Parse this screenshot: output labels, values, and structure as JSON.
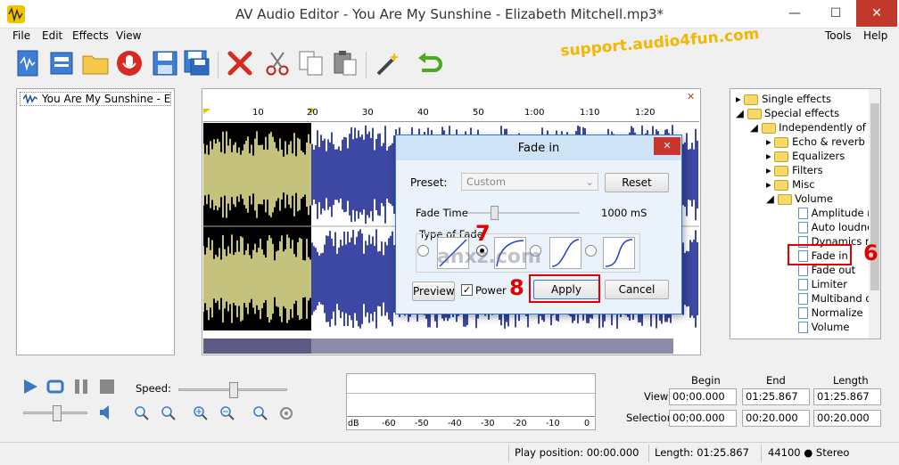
{
  "window": {
    "title": "AV Audio Editor - You Are My Sunshine - Elizabeth Mitchell.mp3*",
    "min": "—",
    "max": "☐",
    "close": "✕"
  },
  "menu": {
    "file": "File",
    "edit": "Edit",
    "effects": "Effects",
    "view": "View",
    "tools": "Tools",
    "help": "Help"
  },
  "brand": "support.audio4fun.com",
  "file_item": "You Are My Sunshine - Elizabe",
  "timeline": {
    "ticks": [
      "10",
      "20",
      "30",
      "40",
      "50",
      "1:00",
      "1:10",
      "1:20"
    ]
  },
  "close_wave": "✕",
  "tree": {
    "single_effects": "Single effects",
    "special_effects": "Special effects",
    "independently": "Independently of cha",
    "echo": "Echo & reverb",
    "equalizers": "Equalizers",
    "filters": "Filters",
    "misc": "Misc",
    "volume": "Volume",
    "items": [
      "Amplitude mo",
      "Auto loudnes",
      "Dynamics mo",
      "Fade in",
      "Fade out",
      "Limiter",
      "Multiband dy",
      "Normalize",
      "Volume"
    ]
  },
  "dialog": {
    "title": "Fade in",
    "preset_label": "Preset:",
    "preset_value": "Custom",
    "reset": "Reset",
    "fade_time_label": "Fade Time",
    "fade_time_value": "1000 mS",
    "type_label": "Type of Fade",
    "preview": "Preview",
    "power": "Power",
    "apply": "Apply",
    "cancel": "Cancel"
  },
  "markers": {
    "six": "6",
    "seven": "7",
    "eight": "8"
  },
  "watermark": "anxz.com",
  "transport": {
    "speed_label": "Speed:"
  },
  "meter": {
    "ticks": [
      "dB",
      "-60",
      "-50",
      "-40",
      "-30",
      "-20",
      "-10",
      "0"
    ]
  },
  "positions": {
    "begin_label": "Begin",
    "end_label": "End",
    "length_label": "Length",
    "view_label": "View",
    "selection_label": "Selection",
    "view_begin": "00:00.000",
    "view_end": "01:25.867",
    "view_length": "01:25.867",
    "sel_begin": "00:00.000",
    "sel_end": "00:20.000",
    "sel_length": "00:20.000"
  },
  "status": {
    "play_position": "Play position: 00:00.000",
    "length": "Length: 01:25.867",
    "format": "44100 ● Stereo"
  },
  "colors": {
    "selection_wave": "#f6f29c",
    "wave": "#0b1a8c",
    "marker": "#e00000",
    "accent": "#3a78c4"
  }
}
